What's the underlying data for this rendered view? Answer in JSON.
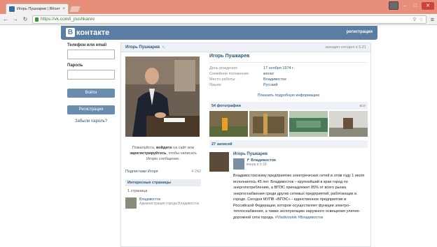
{
  "browser": {
    "tab_title": "Игорь Пушкарев | ВКонт",
    "tab_close": "×",
    "url": "https://vk.com/i_pushkarev",
    "window_min": "–",
    "window_max": "□",
    "window_close": "✕"
  },
  "vk": {
    "logo_letter": "В",
    "logo_text": "контакте",
    "register_link": "регистрация"
  },
  "sidebar": {
    "phone_label": "Телефон или email",
    "password_label": "Пароль",
    "login_button": "Войти",
    "signup_button": "Регистрация",
    "forgot_link": "Забыли пароль?"
  },
  "profile": {
    "header_name": "Игорь Пушкарев",
    "last_seen": "заходил сегодня в 5:21",
    "name": "Игорь Пушкарев",
    "info": [
      {
        "key": "День рождения:",
        "value": "17 ноября 1974 г."
      },
      {
        "key": "Семейное положение:",
        "value": "женат"
      },
      {
        "key": "Место работы:",
        "value": "Владивосток"
      },
      {
        "key": "Языки:",
        "value": "Русский"
      }
    ],
    "show_more": "Показать подробную информацию",
    "message_box": {
      "pre": "Пожалуйста, ",
      "login": "войдите",
      "mid": " на сайт или ",
      "register": "зарегистрируйтесь",
      "post": ", чтобы написать Игорю сообщение."
    },
    "followers_label": "Подписчики Игоря",
    "followers_count": "4 242",
    "interesting_head": "Интересные страницы",
    "interesting_sub": "1 страница",
    "page_title": "Владивосток",
    "page_desc": "Администрация города Владивосток",
    "photos_head": "54 фотографии",
    "photos_all": "все",
    "posts_head": "27 записей",
    "post": {
      "author": "Игорь Пушкарев",
      "repost_name": "Владивосток",
      "repost_time": "вчера в 5:18",
      "text": "Владивостокскому предприятию электрических сетей в этом году 1 июля исполнилось 45 лет. Владивосток – крупнейший в крае город по энергопотреблению, а ВПЭС принадлежит 85% от всего рынка энергоснабжения среди других сетевых предприятий, работающих в городе. Сегодня МУПВ «ВПЭС» - единственное предприятие в Российской Федерации, которое осуществляет функции электро-теплоснабжения, а также эксплуатацию наружного освещения улично-дорожной сети города.",
      "tags": "#Vladivostok #Владивосток"
    }
  },
  "colors": {
    "vk_blue": "#597da3",
    "link": "#2b587a",
    "chrome": "#e88f7c"
  }
}
